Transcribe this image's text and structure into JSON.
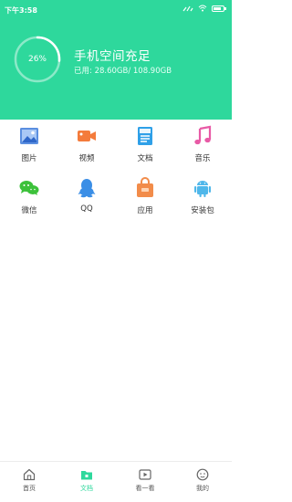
{
  "status_bar": {
    "time": "下午3:58"
  },
  "storage": {
    "percent_label": "26%",
    "percent_value": 26,
    "title": "手机空间充足",
    "used_text": "已用: 28.60GB/ 108.90GB"
  },
  "categories": [
    {
      "label": "图片",
      "icon": "image-icon"
    },
    {
      "label": "视频",
      "icon": "video-camera-icon"
    },
    {
      "label": "文档",
      "icon": "document-icon"
    },
    {
      "label": "音乐",
      "icon": "music-note-icon"
    },
    {
      "label": "微信",
      "icon": "wechat-icon"
    },
    {
      "label": "QQ",
      "icon": "qq-penguin-icon"
    },
    {
      "label": "应用",
      "icon": "shopping-bag-icon"
    },
    {
      "label": "安装包",
      "icon": "android-icon"
    }
  ],
  "bottom_nav": [
    {
      "label": "首页",
      "icon": "home-icon",
      "active": false
    },
    {
      "label": "文档",
      "icon": "folder-icon",
      "active": true
    },
    {
      "label": "看一看",
      "icon": "play-icon",
      "active": false
    },
    {
      "label": "我的",
      "icon": "profile-face-icon",
      "active": false
    }
  ],
  "colors": {
    "accent": "#2ed89c",
    "image_icon": "#5b8fe0",
    "video_icon": "#f47b3b",
    "document_icon": "#2fa0e8",
    "music_icon": "#e85aa6",
    "wechat_icon": "#3cc13a",
    "qq_icon": "#3a8ee6",
    "app_icon": "#f28c4a",
    "android_icon": "#4fb7ea"
  }
}
